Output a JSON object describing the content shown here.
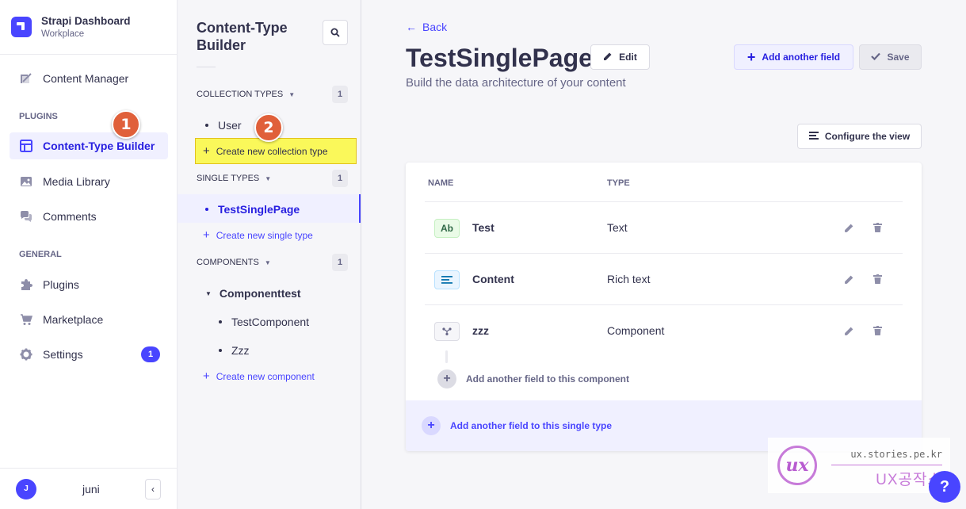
{
  "brand": {
    "title": "Strapi Dashboard",
    "subtitle": "Workplace"
  },
  "mainnav": {
    "content_manager": "Content Manager",
    "plugins_label": "PLUGINS",
    "ctb": "Content-Type Builder",
    "media": "Media Library",
    "comments": "Comments",
    "general_label": "GENERAL",
    "plugins": "Plugins",
    "marketplace": "Marketplace",
    "settings": "Settings",
    "settings_badge": "1"
  },
  "user": {
    "initial": "J",
    "name": "juni"
  },
  "annotations": {
    "step1": "1",
    "step2": "2"
  },
  "subnav": {
    "title": "Content-Type Builder",
    "collection_label": "COLLECTION TYPES",
    "collection_count": "1",
    "collection_items": [
      "User"
    ],
    "create_collection": "Create new collection type",
    "single_label": "SINGLE TYPES",
    "single_count": "1",
    "single_items": [
      "TestSinglePage"
    ],
    "create_single": "Create new single type",
    "components_label": "COMPONENTS",
    "components_count": "1",
    "component_group": "Componenttest",
    "component_items": [
      "TestComponent",
      "Zzz"
    ],
    "create_component": "Create new component"
  },
  "main": {
    "back": "Back",
    "title": "TestSinglePage",
    "edit": "Edit",
    "subtitle": "Build the data architecture of your content",
    "add_field": "Add another field",
    "save": "Save",
    "configure": "Configure the view",
    "columns": {
      "name": "NAME",
      "type": "TYPE"
    },
    "fields": [
      {
        "icon": "Ab",
        "name": "Test",
        "type": "Text"
      },
      {
        "icon": "rich-text-icon",
        "name": "Content",
        "type": "Rich text"
      },
      {
        "icon": "component-icon",
        "name": "zzz",
        "type": "Component"
      }
    ],
    "add_to_component": "Add another field to this component",
    "add_to_single": "Add another field to this single type"
  },
  "watermark": {
    "url": "ux.stories.pe.kr",
    "name": "UX공작소",
    "logo": "ux"
  },
  "help": "?",
  "colors": {
    "primary": "#4945ff",
    "highlight": "#faf85a",
    "step": "#e0603a"
  }
}
